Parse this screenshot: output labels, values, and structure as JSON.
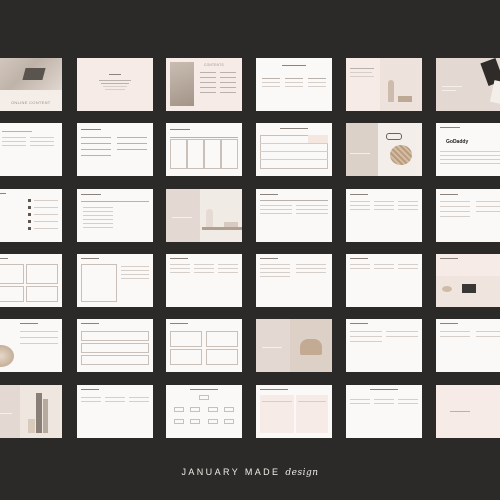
{
  "brand": {
    "name": "JANUARY MADE",
    "script": "design"
  },
  "thumbs": {
    "cover_title": "ONLINE CONTENT",
    "contents_title": "CONTENTS",
    "godaddy": "GoDaddy"
  },
  "colors": {
    "background": "#2b2a29",
    "page": "#fbf9f7",
    "blush": "#f6ebe6",
    "taupe": "#e3d9d2"
  }
}
